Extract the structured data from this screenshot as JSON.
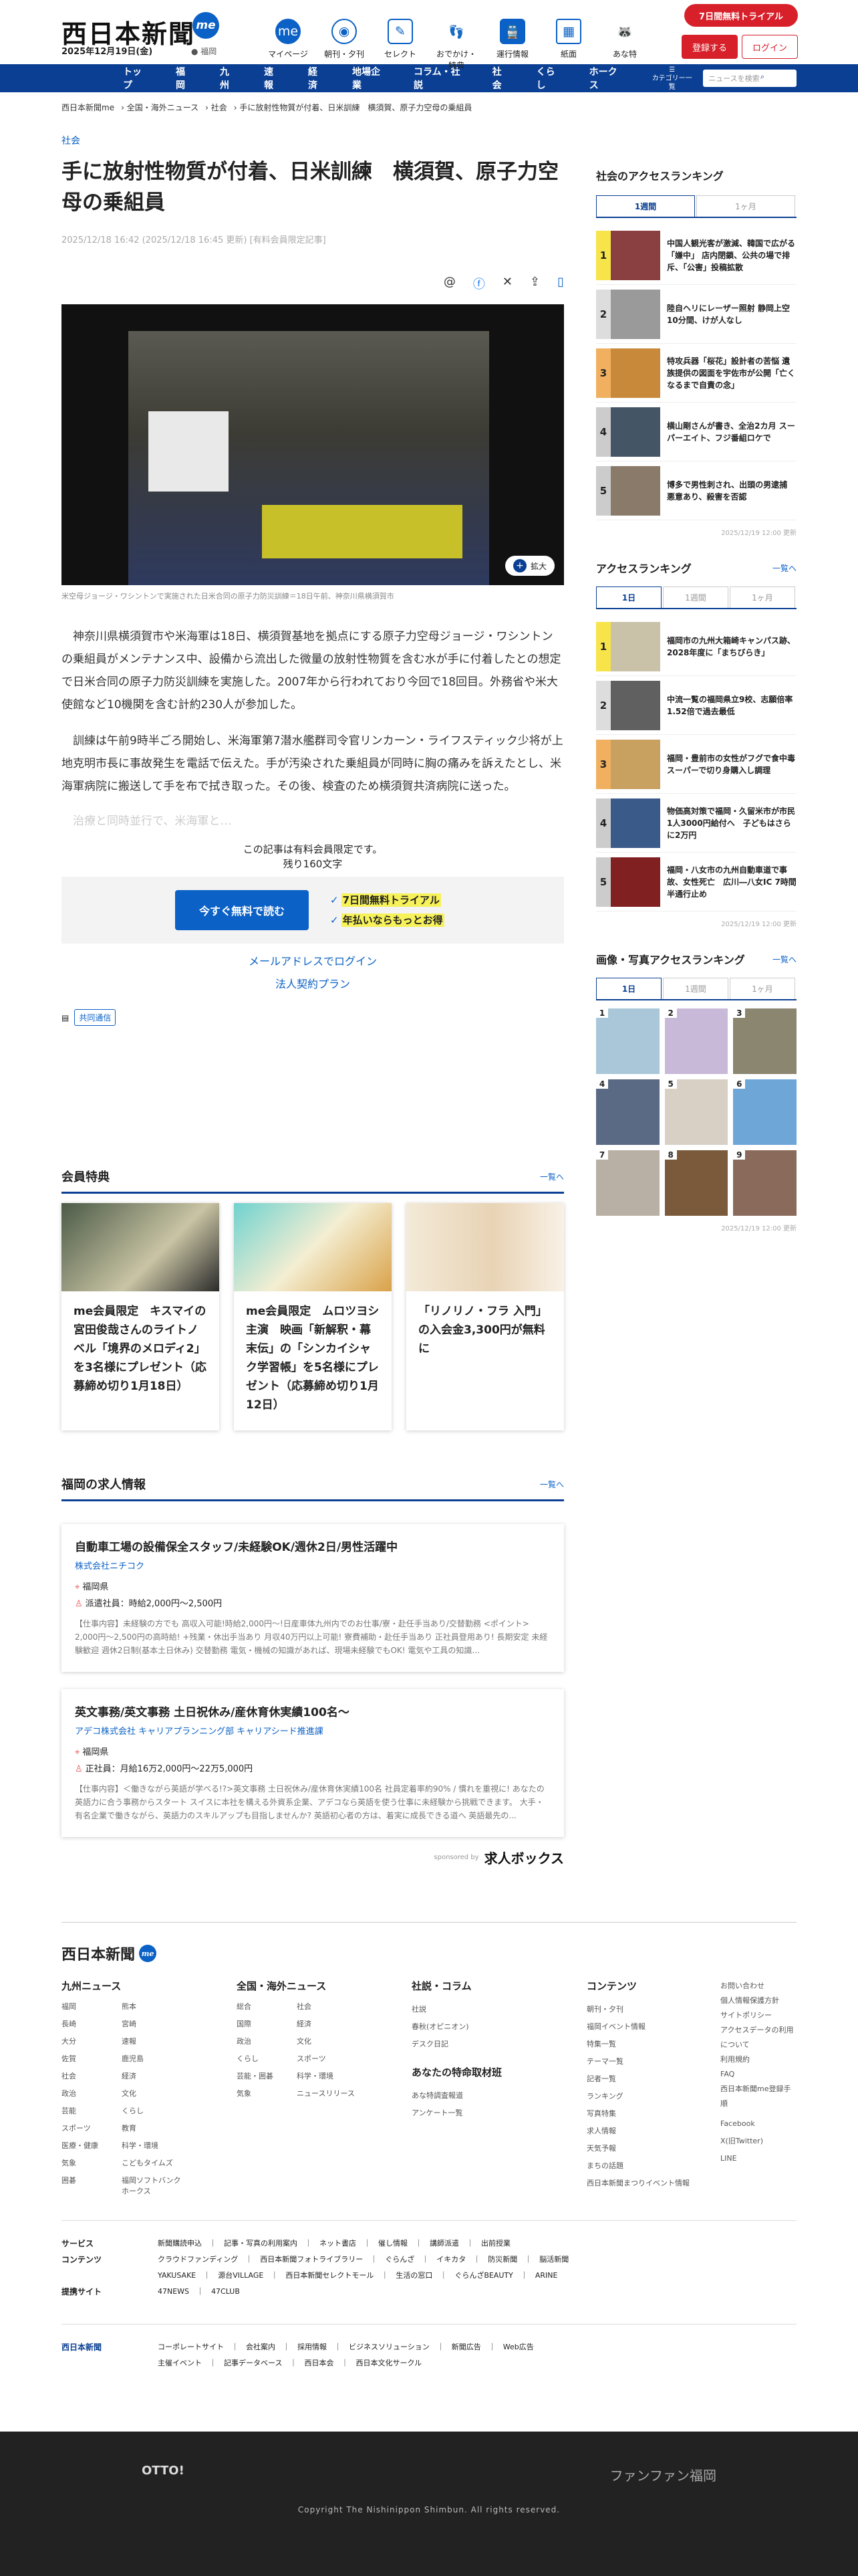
{
  "header": {
    "logo": "西日本新聞",
    "logo_badge": "me",
    "date": "2025年12月19日(金)",
    "region": "福岡",
    "nav": [
      "マイページ",
      "朝刊・夕刊",
      "セレクト",
      "おでかけ・特典",
      "運行情報",
      "紙面",
      "あな特"
    ],
    "trial": "7日間無料トライアル",
    "register": "登録する",
    "login": "ログイン"
  },
  "globalnav": {
    "items": [
      "トップ",
      "福岡",
      "九州",
      "速報",
      "経済",
      "地場企業",
      "コラム・社説",
      "社会",
      "くらし",
      "ホークス"
    ],
    "category": "カテゴリー一覧",
    "search_placeholder": "ニュースを検索"
  },
  "breadcrumb": [
    "西日本新聞me",
    "全国・海外ニュース",
    "社会",
    "手に放射性物質が付着、日米訓練　横須賀、原子力空母の乗組員"
  ],
  "article": {
    "category": "社会",
    "title": "手に放射性物質が付着、日米訓練　横須賀、原子力空母の乗組員",
    "meta": "2025/12/18 16:42 (2025/12/18 16:45 更新) [有料会員限定記事]",
    "zoom": "拡大",
    "caption": "米空母ジョージ・ワシントンで実施された日米合同の原子力防災訓練＝18日午前、神奈川県横須賀市",
    "paragraphs": [
      "神奈川県横須賀市や米海軍は18日、横須賀基地を拠点にする原子力空母ジョージ・ワシントンの乗組員がメンテナンス中、設備から流出した微量の放射性物質を含む水が手に付着したとの想定で日米合同の原子力防災訓練を実施した。2007年から行われており今回で18回目。外務省や米大使館など10機関を含む計約230人が参加した。",
      "訓練は午前9時半ごろ開始し、米海軍第7潜水艦群司令官リンカーン・ライフスティック少将が上地克明市長に事故発生を電話で伝えた。手が汚染された乗組員が同時に胸の痛みを訴えたとし、米海軍病院に搬送して手を布で拭き取った。その後、検査のため横須賀共済病院に送った。"
    ],
    "fade": "治療と同時並行で、米海軍と…",
    "paywall_note": "この記事は有料会員限定です。",
    "paywall_remain": "残り160文字",
    "paywall_button": "今すぐ無料で読む",
    "paywall_points": [
      "7日間無料トライアル",
      "年払いならもっとお得"
    ],
    "login_link": "メールアドレスでログイン",
    "corp_link": "法人契約プラン",
    "source_tag": "共同通信"
  },
  "benefits": {
    "heading": "会員特典",
    "more": "一覧へ",
    "items": [
      "me会員限定　キスマイの宮田俊哉さんのライトノベル「境界のメロディ2」を3名様にプレゼント（応募締め切り1月18日）",
      "me会員限定　ムロツヨシ主演　映画「新解釈・幕末伝」の「シンカイシャク学習帳」を5名様にプレゼント（応募締め切り1月12日）",
      "「リノリノ・フラ 入門」の入会金3,300円が無料に"
    ]
  },
  "jobs": {
    "heading": "福岡の求人情報",
    "more": "一覧へ",
    "items": [
      {
        "title": "自動車工場の設備保全スタッフ/未経験OK/週休2日/男性活躍中",
        "company": "株式会社ニチコク",
        "place": "福岡県",
        "pay": "派遣社員：時給2,000円〜2,500円",
        "desc": "【仕事内容】未経験の方でも 高収入可能!時給2,000円〜!日産車体九州内でのお仕事/寮・赴任手当あり/交替勤務 <ポイント> 2,000円〜2,500円の高時給! +残業・休出手当あり 月収40万円以上可能! 寮費補助・赴任手当あり 正社員登用あり! 長期安定 未経験歓迎 週休2日制(基本土日休み) 交替勤務 電気・機械の知識があれば、現場未経験でもOK! 電気や工具の知識..."
      },
      {
        "title": "英文事務/英文事務 土日祝休み/産休育休実績100名〜",
        "company": "アデコ株式会社 キャリアプランニング部 キャリアシード推進課",
        "place": "福岡県",
        "pay": "正社員：月給16万2,000円〜22万5,000円",
        "desc": "【仕事内容】＜働きながら英語が学べる!?>英文事務 土日祝休み/産休育休実績100名 社員定着率約90% / 慣れを重視に! あなたの英語力に合う事務からスタート スイスに本社を構える外資系企業、アデコなら英語を使う仕事に未経験から挑戦できます。 大手・有名企業で働きながら、英語力のスキルアップも目指しませんか? 英語初心者の方は、着実に成長できる道へ 英語最先の..."
      }
    ],
    "sponsor_label": "sponsored by",
    "sponsor": "求人ボックス"
  },
  "sidebar": {
    "society_heading": "社会のアクセスランキング",
    "society_tabs": [
      "1週間",
      "1ヶ月"
    ],
    "society_items": [
      "中国人観光客が激減、韓国で広がる「嫌中」 店内閉鎖、公共の場で排斥、「公害」投稿拡散",
      "陸自ヘリにレーザー照射 静岡上空10分間、けが人なし",
      "特攻兵器「桜花」設計者の苦悩 遺族提供の図面を宇佐市が公開「亡くなるまで自責の念」",
      "横山剛さんが書き、全治2カ月 スーパーエイト、フジ番組ロケで",
      "博多で男性刺され、出頭の男逮捕　悪意あり、殺害を否認"
    ],
    "society_update": "2025/12/19 12:00 更新",
    "access_heading": "アクセスランキング",
    "access_more": "一覧へ",
    "access_tabs": [
      "1日",
      "1週間",
      "1ヶ月"
    ],
    "access_items": [
      "福岡市の九州大箱崎キャンパス跡、2028年度に「まちびらき」",
      "中流一覧の福岡県立9校、志願倍率1.52倍で過去最低",
      "福岡・豊前市の女性がフグで食中毒　スーパーで切り身購入し調理",
      "物価高対策で福岡・久留米市が市民1人3000円給付へ　子どもはさらに2万円",
      "福岡・八女市の九州自動車道で事故、女性死亡　広川―八女IC 7時間半通行止め"
    ],
    "access_update": "2025/12/19 12:00 更新",
    "photo_heading": "画像・写真アクセスランキング",
    "photo_more": "一覧へ",
    "photo_tabs": [
      "1日",
      "1週間",
      "1ヶ月"
    ],
    "photo_update": "2025/12/19 12:00 更新"
  },
  "footer": {
    "logo": "西日本新聞",
    "cols": [
      {
        "h": "九州ニュース",
        "l": [
          "福岡",
          "熊本",
          "長崎",
          "宮崎",
          "大分",
          "速報",
          "佐賀",
          "鹿児島",
          "社会",
          "経済",
          "政治",
          "文化",
          "芸能",
          "くらし",
          "スポーツ",
          "教育",
          "医療・健康",
          "科学・環境",
          "気象",
          "こどもタイムズ",
          "囲碁",
          "福岡ソフトバンクホークス"
        ]
      },
      {
        "h": "全国・海外ニュース",
        "l": [
          "総合",
          "社会",
          "国際",
          "経済",
          "政治",
          "文化",
          "くらし",
          "スポーツ",
          "芸能・囲碁",
          "科学・環境",
          "気象",
          "ニュースリリース"
        ]
      },
      {
        "h": "社説・コラム",
        "l": [
          "社説",
          "春秋(オピニオン)",
          "デスク日記"
        ],
        "h2": "あなたの特命取材班",
        "l2": [
          "あな特調査報道",
          "アンケート一覧"
        ]
      },
      {
        "h": "コンテンツ",
        "l": [
          "朝刊・夕刊",
          "福岡イベント情報",
          "特集一覧",
          "テーマ一覧",
          "記者一覧",
          "ランキング",
          "写真特集",
          "求人情報",
          "天気予報",
          "まちの話題",
          "西日本新聞まつりイベント情報"
        ]
      }
    ],
    "misc": [
      "お問い合わせ",
      "個人情報保護方針",
      "サイトポリシー",
      "アクセスデータの利用について",
      "利用規約",
      "FAQ",
      "西日本新聞me登録手順"
    ],
    "social": [
      "Facebook",
      "X(旧Twitter)",
      "LINE"
    ],
    "rows": [
      {
        "k": "サービス",
        "v": "新聞購読申込　｜　記事・写真の利用案内　｜　ネット書店　｜　催し情報　｜　講師派遣　｜　出前授業"
      },
      {
        "k": "コンテンツ",
        "v": "クラウドファンディング　｜　西日本新聞フォトライブラリー　｜　ぐらんざ　｜　イキカタ　｜　防災新聞　｜　脳活新聞\nYAKUSAKE　｜　源台VILLAGE　｜　西日本新聞セレクトモール　｜　生活の窓口　｜　ぐらんざBEAUTY　｜　ARINE"
      },
      {
        "k": "提携サイト",
        "v": "47NEWS　｜　47CLUB"
      }
    ],
    "corp_logo": "西日本新聞",
    "corp_links": "コーポレートサイト　｜　会社案内　｜　採用情報　｜　ビジネスソリューション　｜　新聞広告　｜　Web広告\n主催イベント　｜　記事データベース　｜　西日本会　｜　西日本文化サークル",
    "otto": "OTTO!",
    "fan": "ファンファン福岡",
    "copyright": "Copyright The Nishinippon Shimbun. All rights reserved."
  }
}
